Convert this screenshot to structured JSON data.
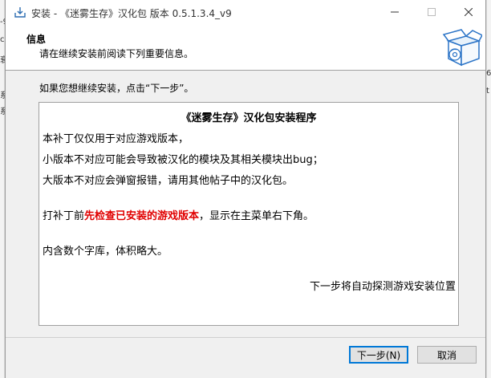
{
  "window": {
    "title": "安装 - 《迷雾生存》汉化包 版本 0.5.1.3.4_v9"
  },
  "header": {
    "title": "信息",
    "subtitle": "请在继续安装前阅读下列重要信息。"
  },
  "body": {
    "intro": "如果您想继续安装，点击“下一步”。"
  },
  "memo": {
    "title": "《迷雾生存》汉化包安装程序",
    "line1": "本补丁仅仅用于对应游戏版本，",
    "line2": "小版本不对应可能会导致被汉化的模块及其相关模块出bug；",
    "line3": "大版本不对应会弹窗报错，请用其他帖子中的汉化包。",
    "line4_before": "打补丁前",
    "line4_red": "先检查已安装的游戏版本",
    "line4_after": "，显示在主菜单右下角。",
    "line5": "内含数个字库，体积略大。",
    "line6": "下一步将自动探测游戏安装位置"
  },
  "buttons": {
    "next_label": "下一步(N)",
    "cancel_label": "取消"
  },
  "background": {
    "left_fragments": [
      "-9",
      "ch",
      "衰",
      "系",
      "系"
    ],
    "right_fragments": [
      "6",
      "t"
    ]
  },
  "colors": {
    "accent": "#0078d7",
    "warning_red": "#e00000",
    "window_bg": "#f0f0f0"
  },
  "icons": {
    "app": "installer-box-icon",
    "header": "software-box-disc-icon",
    "minimize": "minimize-icon",
    "maximize": "maximize-icon",
    "close": "close-icon"
  }
}
